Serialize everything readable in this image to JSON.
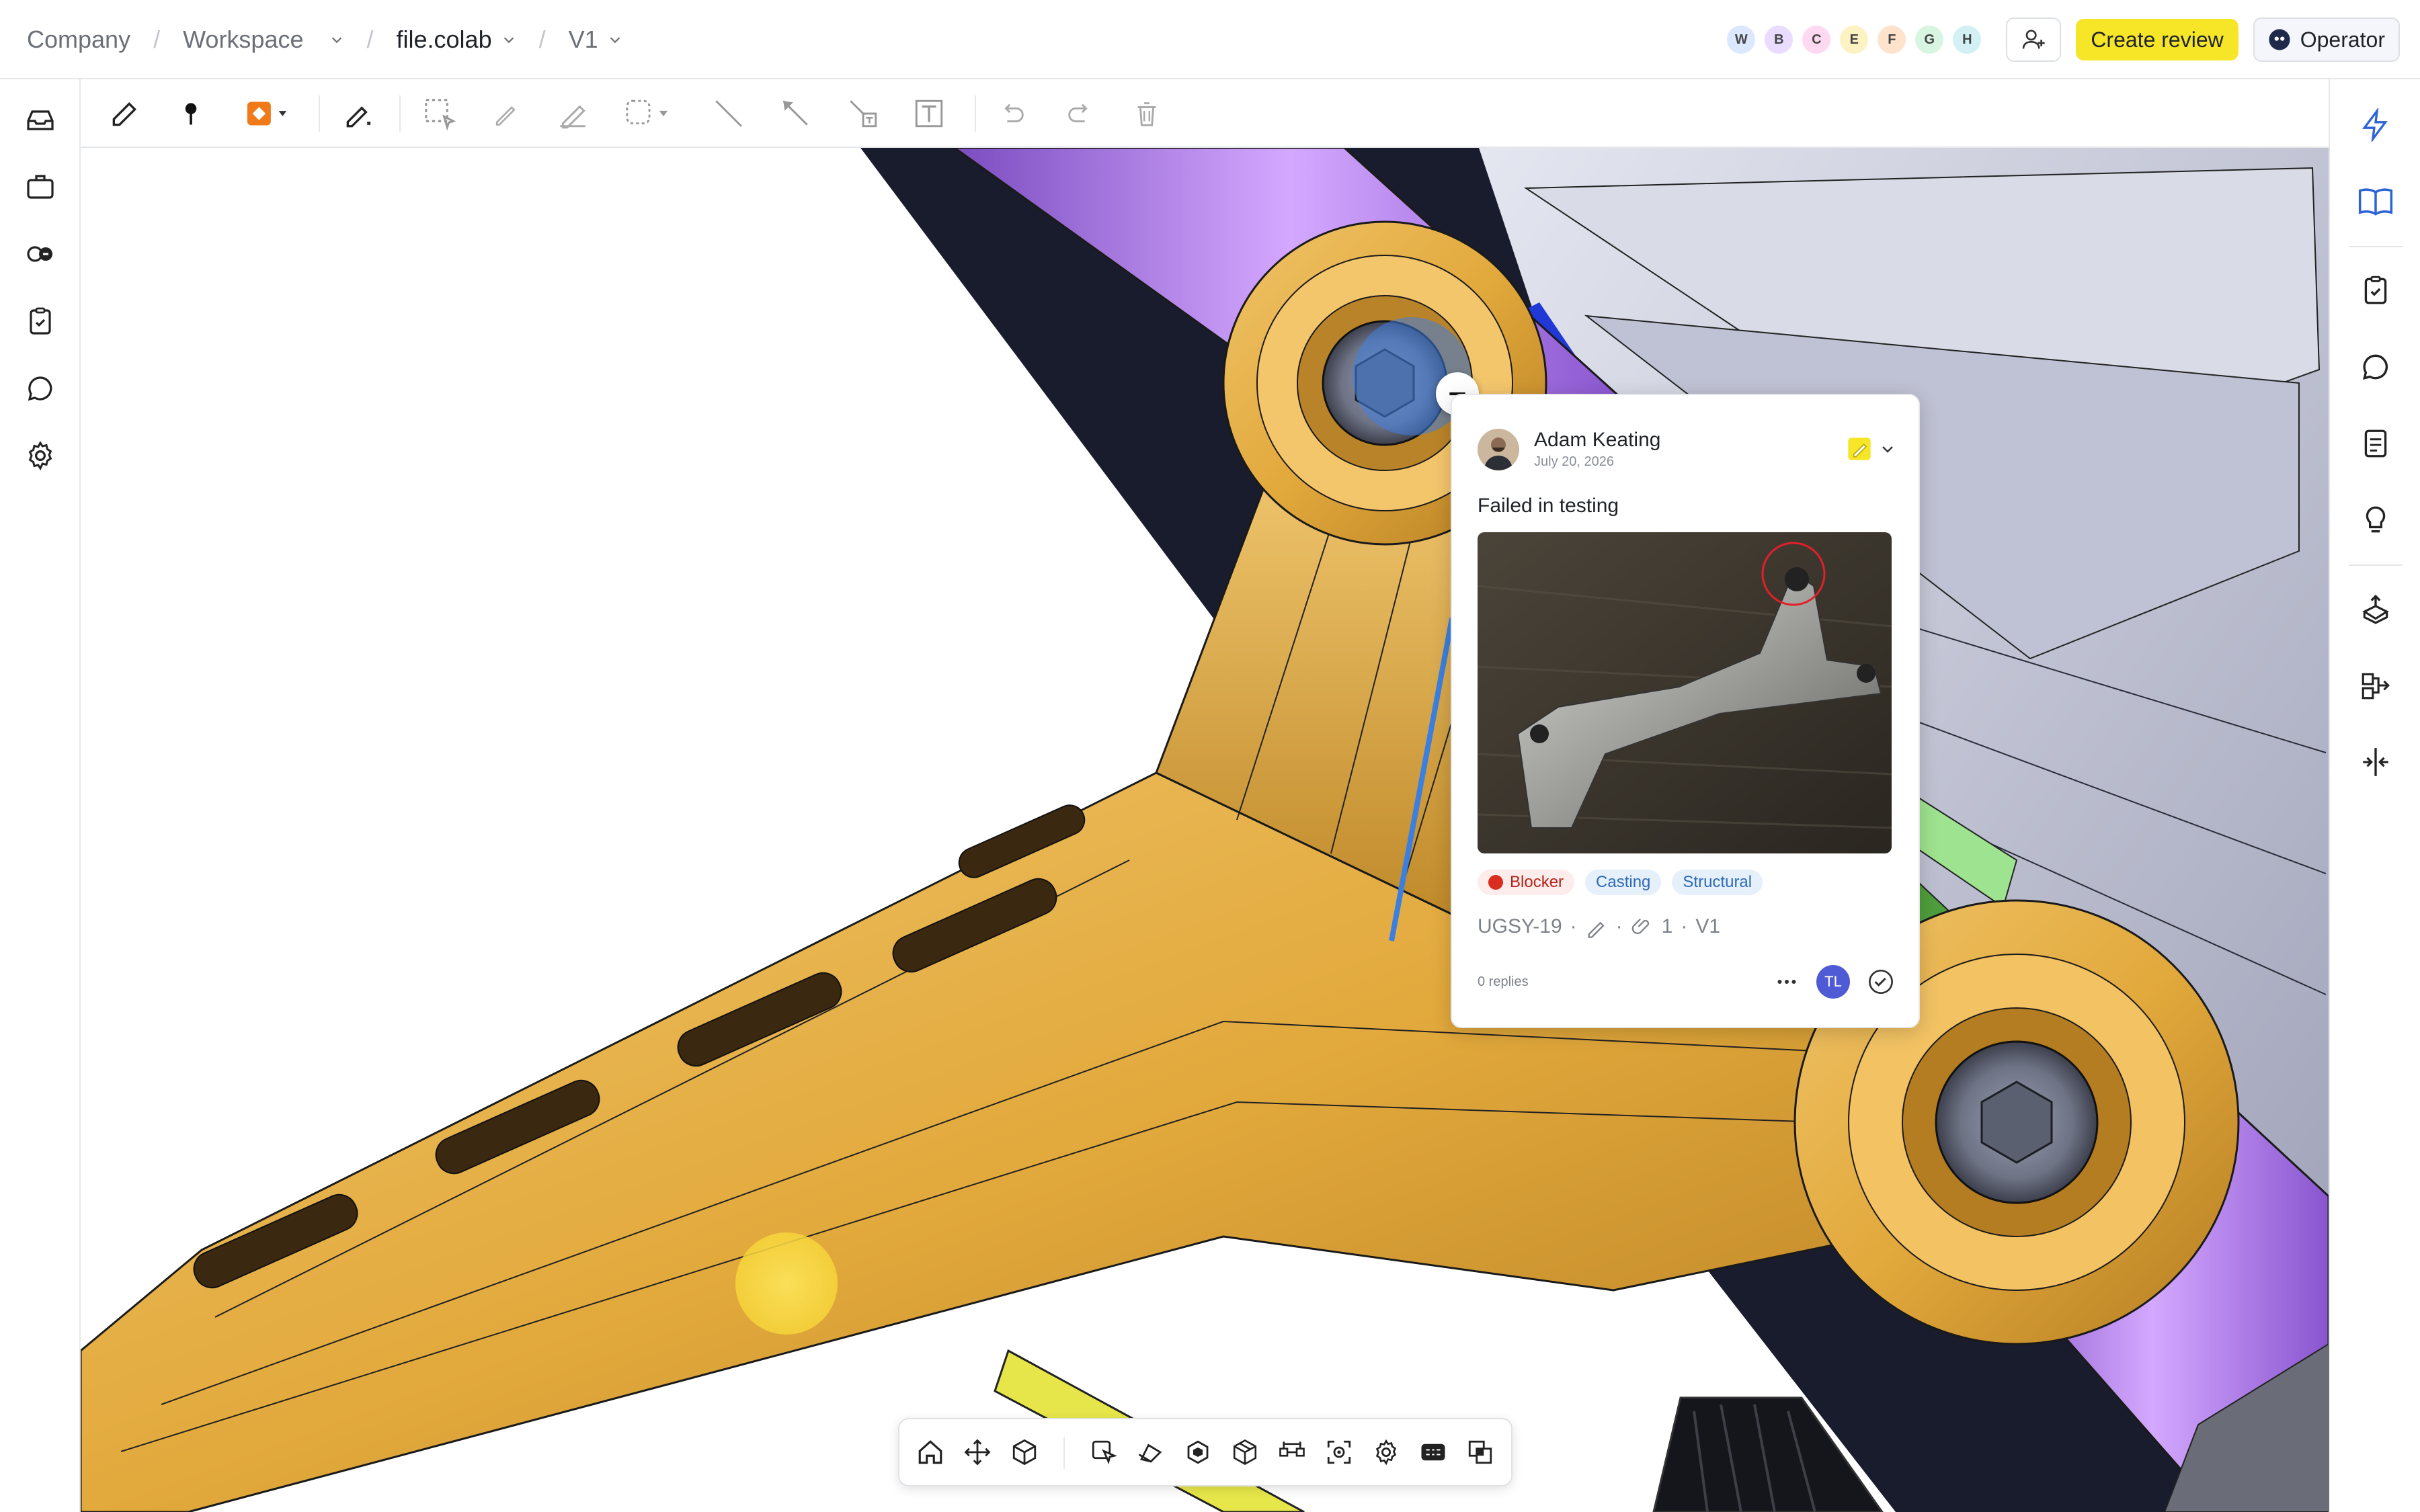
{
  "breadcrumb": {
    "company": "Company",
    "workspace": "Workspace",
    "file": "file.colab",
    "version": "V1"
  },
  "header": {
    "avatars": [
      {
        "letter": "W",
        "color": "#dbe8ff"
      },
      {
        "letter": "B",
        "color": "#eadcff"
      },
      {
        "letter": "C",
        "color": "#ffd9f2"
      },
      {
        "letter": "E",
        "color": "#fdf3c2"
      },
      {
        "letter": "F",
        "color": "#ffe3cc"
      },
      {
        "letter": "G",
        "color": "#d8f5e1"
      },
      {
        "letter": "H",
        "color": "#d3f1f5"
      }
    ],
    "create_review_label": "Create review",
    "operator_label": "Operator"
  },
  "comment": {
    "author": "Adam Keating",
    "date": "July 20, 2026",
    "text": "Failed in testing",
    "tags": [
      "Blocker",
      "Casting",
      "Structural"
    ],
    "id": "UGSY-19",
    "attachments": "1",
    "version": "V1",
    "replies": "0 replies",
    "assignee_initials": "TL"
  },
  "colors": {
    "accent_yellow": "#f7e628",
    "part_gold": "#e2a93c",
    "part_purple": "#a877e0",
    "blocker_red": "#d92d20",
    "assignee_blue": "#4f5bd5"
  }
}
